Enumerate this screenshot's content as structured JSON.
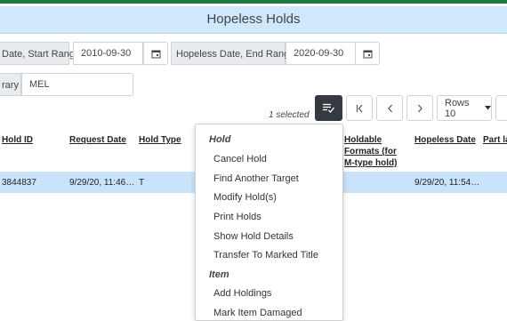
{
  "app": {
    "title": "Hopeless Holds"
  },
  "filters": {
    "start_label": "Date, Start Range:",
    "start_value": "2010-09-30",
    "end_label": "Hopeless Date, End Range:",
    "end_value": "2020-09-30",
    "library_label": "rary",
    "library_value": "MEL"
  },
  "toolbar": {
    "selected_text": "1 selected",
    "rows_label": "Rows 10"
  },
  "table": {
    "columns": [
      "Hold ID",
      "Request Date",
      "Hold Type",
      "Holdable Formats (for M-type hold)",
      "Hopeless Date",
      "Part la"
    ],
    "holdable_lines": [
      "Holdable",
      "Formats (for",
      "M-type hold)"
    ],
    "row": {
      "hold_id": "3844837",
      "request_date": "9/29/20, 11:46…",
      "hold_type": "T",
      "hopeless_date": "9/29/20, 11:54…"
    }
  },
  "actions_menu": {
    "section_hold": "Hold",
    "items_hold": [
      "Cancel Hold",
      "Find Another Target",
      "Modify Hold(s)",
      "Print Holds",
      "Show Hold Details",
      "Transfer To Marked Title"
    ],
    "section_item": "Item",
    "items_item": [
      "Add Holdings",
      "Mark Item Damaged"
    ]
  }
}
